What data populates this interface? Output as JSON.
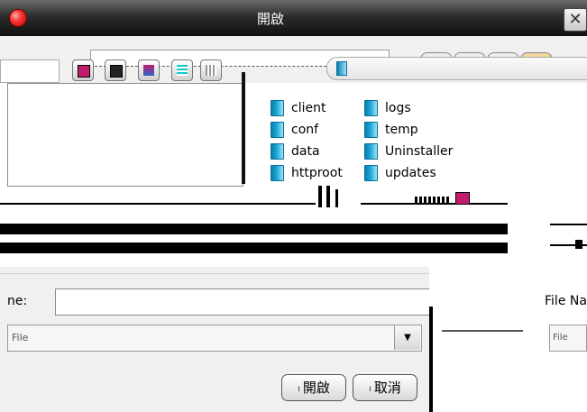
{
  "window": {
    "title": "開啟",
    "close_glyph": "✕"
  },
  "files": {
    "column1": [
      "client",
      "conf",
      "data",
      "httproot"
    ],
    "column2": [
      "logs",
      "temp",
      "Uninstaller",
      "updates"
    ]
  },
  "form": {
    "file_name_label": "ne:",
    "file_name_value": "",
    "file_type_value": "File",
    "right_file_name_label": "File Na",
    "right_file_type_value": "File"
  },
  "buttons": {
    "open_label": "開啟",
    "cancel_label": "取消",
    "accel_mark": "ı"
  },
  "icons": {
    "app": "red-orb-icon",
    "folder": "folder-icon",
    "dropdown": "chevron-down-icon"
  }
}
